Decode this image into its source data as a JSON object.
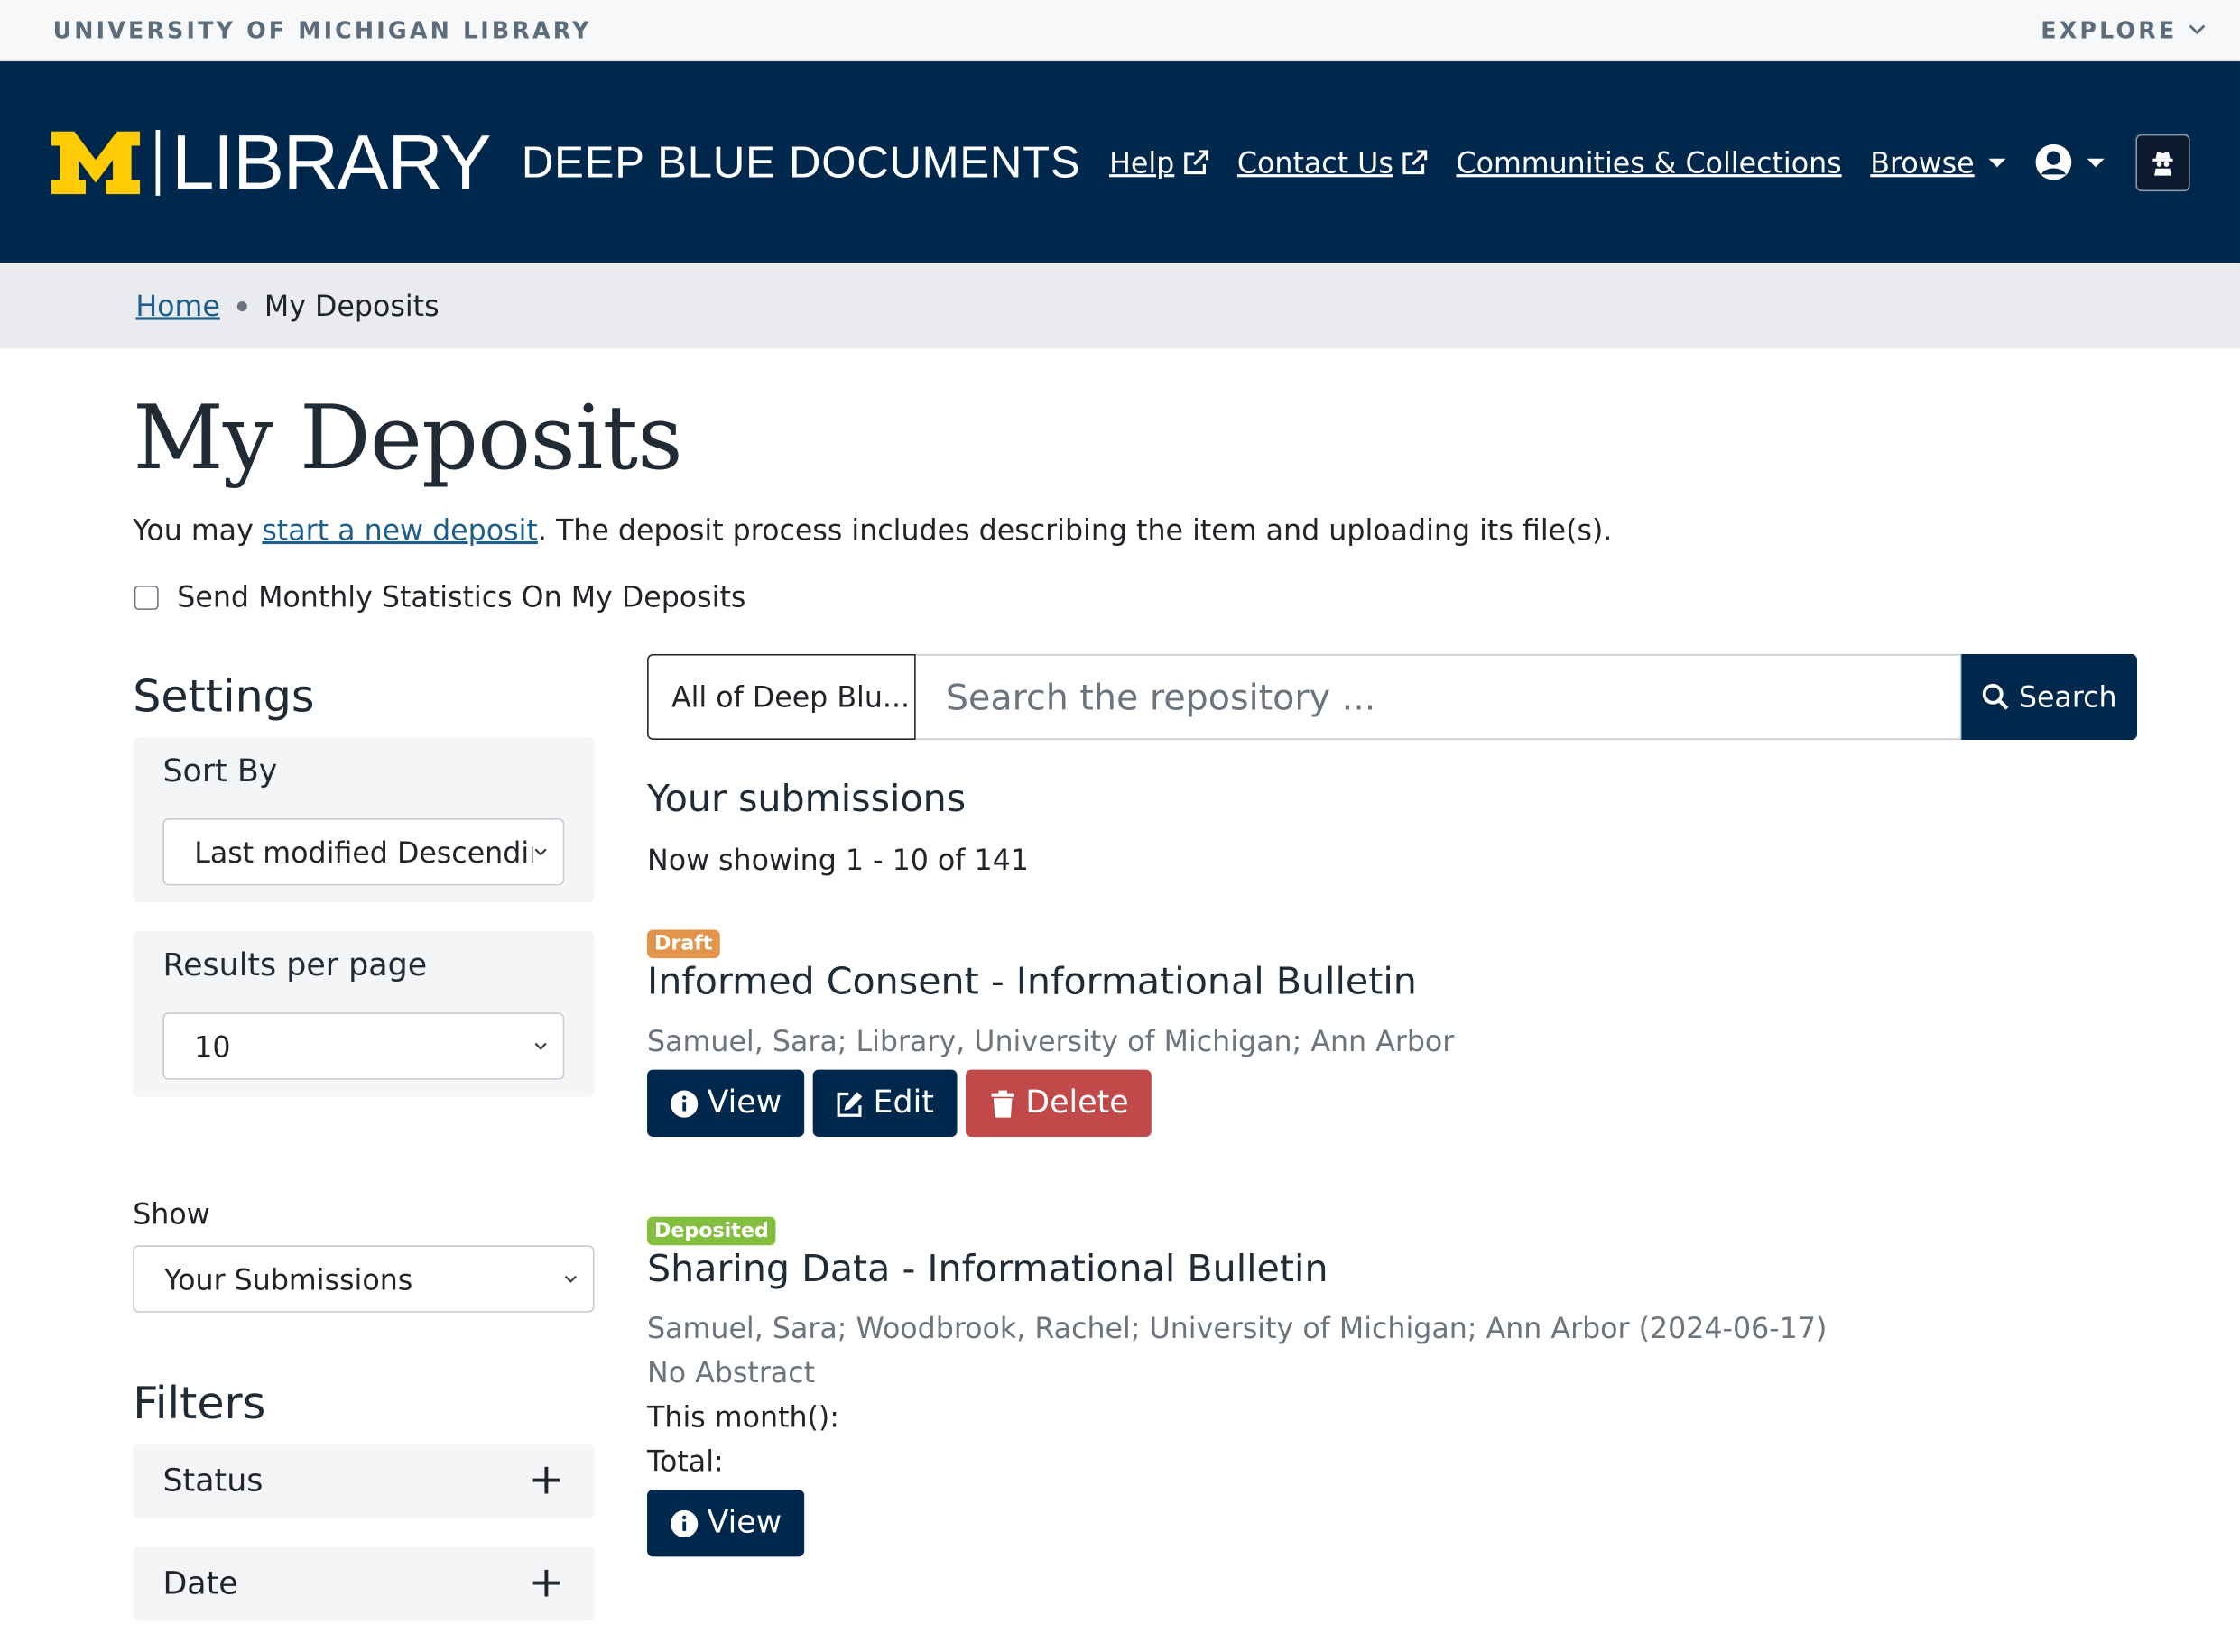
{
  "utility": {
    "university": "UNIVERSITY OF MICHIGAN LIBRARY",
    "explore": "EXPLORE"
  },
  "header": {
    "logo_word": "LIBRARY",
    "site_title": "DEEP BLUE DOCUMENTS",
    "nav": {
      "help": "Help",
      "contact": "Contact Us",
      "communities": "Communities & Collections",
      "browse": "Browse"
    }
  },
  "breadcrumb": {
    "home": "Home",
    "current": "My Deposits"
  },
  "page": {
    "title": "My Deposits",
    "intro_prefix": "You may",
    "intro_link": "start a new deposit",
    "intro_suffix": ". The deposit process includes describing the item and uploading its file(s).",
    "stats_checkbox_label": "Send Monthly Statistics On My Deposits",
    "stats_checked": false
  },
  "sidebar": {
    "settings_heading": "Settings",
    "sort_by": {
      "label": "Sort By",
      "value": "Last modified Descending"
    },
    "results_per_page": {
      "label": "Results per page",
      "value": "10"
    },
    "show": {
      "label": "Show",
      "value": "Your Submissions"
    },
    "filters_heading": "Filters",
    "facets": [
      "Status",
      "Date"
    ]
  },
  "search": {
    "scope": "All of Deep Blu...",
    "placeholder": "Search the repository ...",
    "button": "Search"
  },
  "results": {
    "heading": "Your submissions",
    "showing": "Now showing 1 - 10 of 141",
    "items": [
      {
        "badge": "Draft",
        "title": "Informed Consent - Informational Bulletin",
        "meta": "Samuel, Sara; Library, University of Michigan; Ann Arbor",
        "view": "View",
        "edit": "Edit",
        "delete": "Delete"
      },
      {
        "badge": "Deposited",
        "title": "Sharing Data - Informational Bulletin",
        "meta": "Samuel, Sara; Woodbrook, Rachel; University of Michigan; Ann Arbor (2024-06-17)",
        "abstract": "No Abstract",
        "this_month": "This month():",
        "total": "Total:",
        "view": "View"
      }
    ]
  },
  "colors": {
    "navy": "#00274c",
    "maize": "#ffcb05",
    "draft_badge": "#e2954a",
    "deposited_badge": "#83be3f",
    "danger": "#c1494a",
    "link": "#1d5f8c"
  }
}
